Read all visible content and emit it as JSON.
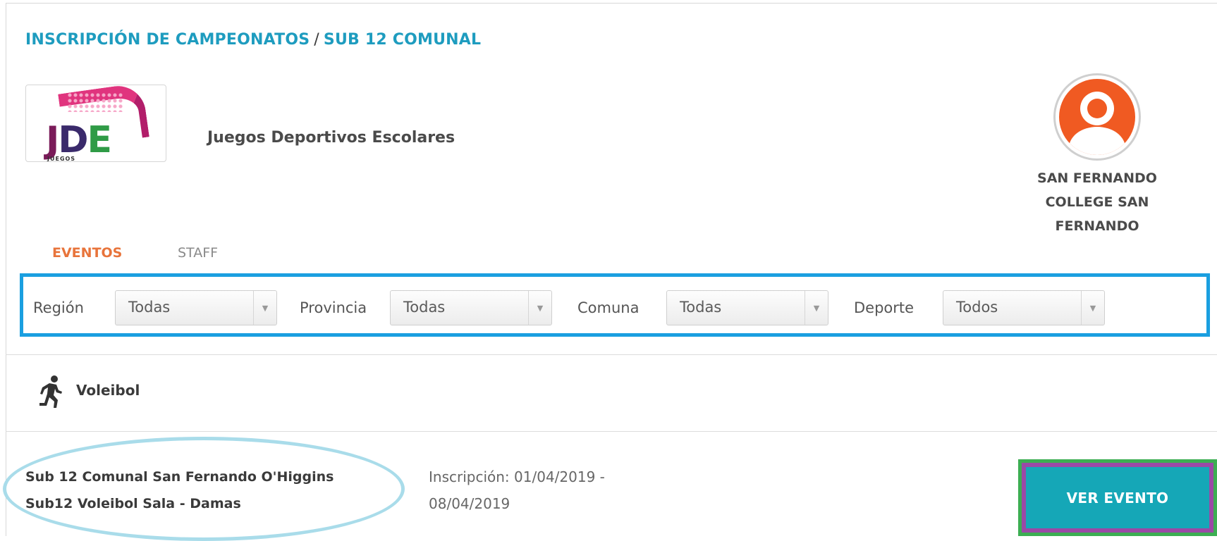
{
  "breadcrumb": {
    "section": "INSCRIPCIÓN DE CAMPEONATOS",
    "separator": "/",
    "current": "SUB 12 COMUNAL"
  },
  "organization": {
    "logo_text": [
      "J",
      "D",
      "E"
    ],
    "logo_subtext": "JUEGOS",
    "name": "Juegos Deportivos Escolares"
  },
  "user": {
    "avatar_icon": "user-avatar-icon",
    "name_lines": [
      "SAN FERNANDO",
      "COLLEGE SAN",
      "FERNANDO"
    ]
  },
  "tabs": [
    {
      "label": "EVENTOS",
      "active": true
    },
    {
      "label": "STAFF",
      "active": false
    }
  ],
  "filters": [
    {
      "label": "Región",
      "value": "Todas"
    },
    {
      "label": "Provincia",
      "value": "Todas"
    },
    {
      "label": "Comuna",
      "value": "Todas"
    },
    {
      "label": "Deporte",
      "value": "Todos"
    }
  ],
  "sport": {
    "icon": "runner-icon",
    "name": "Voleibol"
  },
  "event": {
    "title_line1": "Sub 12 Comunal San Fernando O'Higgins",
    "title_line2": "Sub12 Voleibol Sala - Damas",
    "dates_line1": "Inscripción: 01/04/2019 -",
    "dates_line2": "08/04/2019",
    "button_label": "VER EVENTO"
  },
  "colors": {
    "accent": "#1e9cbf",
    "active_tab": "#e8743b",
    "button": "#15a7b7",
    "avatar": "#f05a22",
    "highlight_filters": "#1a9fe0",
    "highlight_button_outer": "#3cae52",
    "highlight_button_inner": "#9a49a6",
    "highlight_event": "#a9dcea"
  }
}
